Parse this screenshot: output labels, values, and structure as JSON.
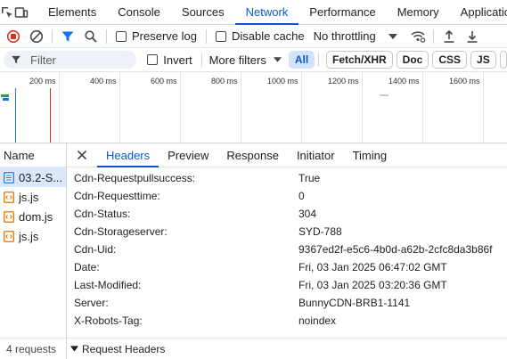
{
  "tabs": [
    "Elements",
    "Console",
    "Sources",
    "Network",
    "Performance",
    "Memory",
    "Application"
  ],
  "active_tab": "Network",
  "toolbar": {
    "preserve_log": "Preserve log",
    "disable_cache": "Disable cache",
    "throttling": "No throttling"
  },
  "filterbar": {
    "placeholder": "Filter",
    "invert": "Invert",
    "more_filters": "More filters",
    "types": [
      "All",
      "Fetch/XHR",
      "Doc",
      "CSS",
      "JS"
    ]
  },
  "timeline": {
    "ticks": [
      "200 ms",
      "400 ms",
      "600 ms",
      "800 ms",
      "1000 ms",
      "1200 ms",
      "1400 ms",
      "1600 ms"
    ]
  },
  "requests": {
    "header": "Name",
    "items": [
      {
        "name": "03.2-S...",
        "type": "document"
      },
      {
        "name": "js.js",
        "type": "script"
      },
      {
        "name": "dom.js",
        "type": "script"
      },
      {
        "name": "js.js",
        "type": "script"
      }
    ],
    "footer": "4 requests"
  },
  "details": {
    "tabs": [
      "Headers",
      "Preview",
      "Response",
      "Initiator",
      "Timing"
    ],
    "active": "Headers",
    "headers": [
      {
        "name": "Cdn-Requestpullsuccess:",
        "value": "True"
      },
      {
        "name": "Cdn-Requesttime:",
        "value": "0"
      },
      {
        "name": "Cdn-Status:",
        "value": "304"
      },
      {
        "name": "Cdn-Storageserver:",
        "value": "SYD-788"
      },
      {
        "name": "Cdn-Uid:",
        "value": "9367ed2f-e5c6-4b0d-a62b-2cfc8da3b86f"
      },
      {
        "name": "Date:",
        "value": "Fri, 03 Jan 2025 06:47:02 GMT"
      },
      {
        "name": "Last-Modified:",
        "value": "Fri, 03 Jan 2025 03:20:36 GMT"
      },
      {
        "name": "Server:",
        "value": "BunnyCDN-BRB1-1141"
      },
      {
        "name": "X-Robots-Tag:",
        "value": "noindex"
      }
    ],
    "section": "Request Headers"
  },
  "colors": {
    "accent": "#0b57d0",
    "record": "#d93025"
  }
}
